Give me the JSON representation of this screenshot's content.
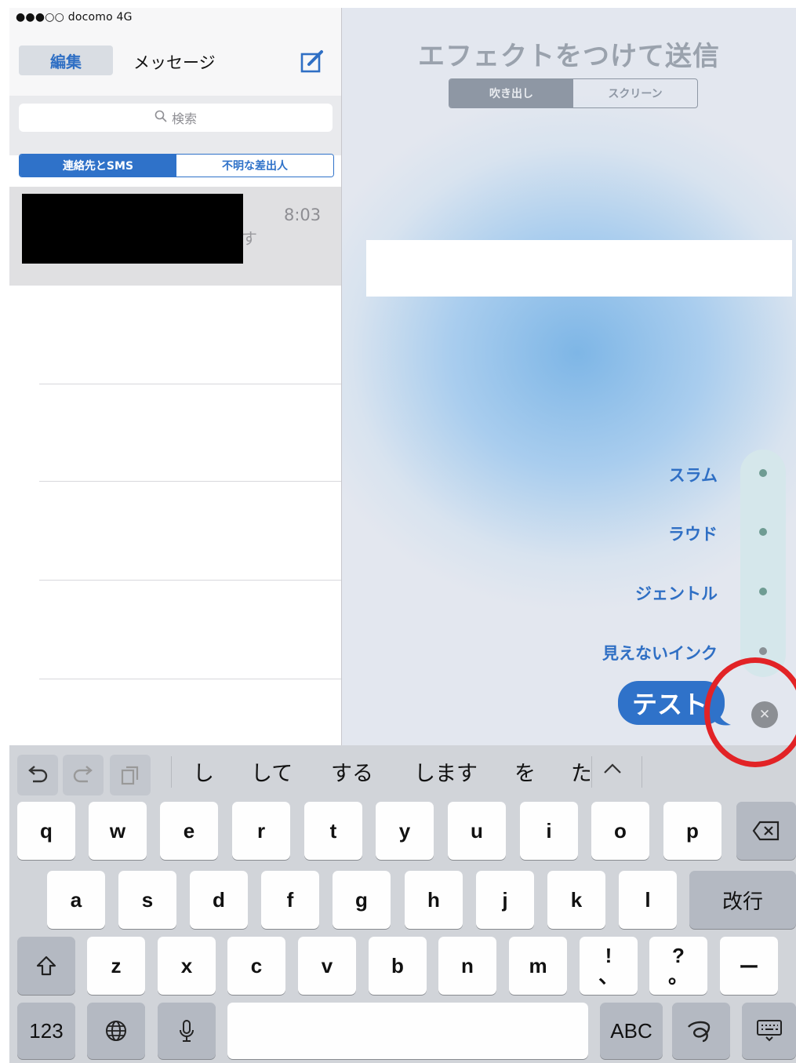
{
  "status_bar": {
    "carrier": "●●●○○ docomo  4G"
  },
  "messages": {
    "edit_label": "編集",
    "title": "メッセージ",
    "search_placeholder": "検索",
    "filter_tabs": [
      "連絡先とSMS",
      "不明な差出人"
    ],
    "conversation": {
      "time": "8:03",
      "preview_peek": "す"
    }
  },
  "effects": {
    "title": "エフェクトをつけて送信",
    "tabs": [
      "吹き出し",
      "スクリーン"
    ],
    "active_tab": 0,
    "options": [
      "スラム",
      "ラウド",
      "ジェントル",
      "見えないインク"
    ],
    "bubble_text": "テスト"
  },
  "keyboard": {
    "candidates": [
      "し",
      "して",
      "する",
      "します",
      "を",
      "た"
    ],
    "row1": [
      "q",
      "w",
      "e",
      "r",
      "t",
      "y",
      "u",
      "i",
      "o",
      "p"
    ],
    "row2": [
      "a",
      "s",
      "d",
      "f",
      "g",
      "h",
      "j",
      "k",
      "l"
    ],
    "return_label": "改行",
    "row3": [
      "z",
      "x",
      "c",
      "v",
      "b",
      "n",
      "m"
    ],
    "punct": [
      {
        "top": "!",
        "bottom": "、"
      },
      {
        "top": "?",
        "bottom": "。"
      }
    ],
    "dash": "ー",
    "numbers_label": "123",
    "abc_label": "ABC"
  },
  "icons": [
    "undo-icon",
    "redo-icon",
    "paste-icon",
    "chevron-up-icon",
    "backspace-icon",
    "shift-icon",
    "globe-icon",
    "mic-icon",
    "handwriting-icon",
    "keyboard-dismiss-icon",
    "compose-icon",
    "search-icon",
    "close-icon"
  ],
  "colors": {
    "accent": "#2f72c9",
    "highlight_circle": "#e22326"
  }
}
